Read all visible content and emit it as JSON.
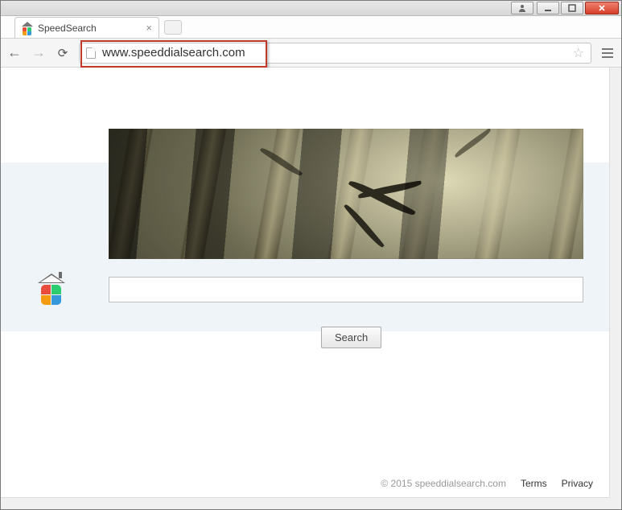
{
  "window": {
    "tab_title": "SpeedSearch"
  },
  "toolbar": {
    "url": "www.speeddialsearch.com"
  },
  "page": {
    "search_button": "Search",
    "search_value": "",
    "search_placeholder": ""
  },
  "footer": {
    "copyright": "© 2015 speeddialsearch.com",
    "terms": "Terms",
    "privacy": "Privacy"
  }
}
